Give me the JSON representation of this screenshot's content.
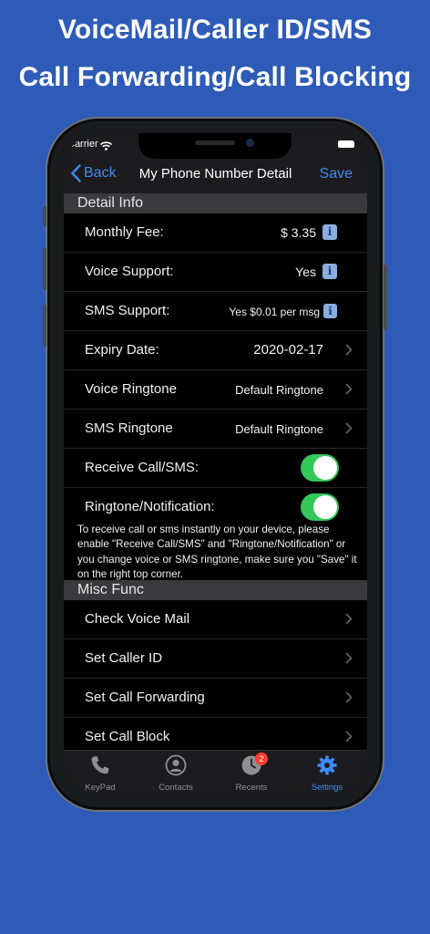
{
  "headline": {
    "line1": "VoiceMail/Caller ID/SMS",
    "line2": "Call Forwarding/Call Blocking"
  },
  "status_bar": {
    "carrier": "Carrier"
  },
  "nav": {
    "back_label": "Back",
    "title": "My Phone Number Detail",
    "save_label": "Save"
  },
  "detail_section": {
    "header": "Detail Info",
    "rows": [
      {
        "label": "Monthly Fee:",
        "value": "$ 3.35"
      },
      {
        "label": "Voice Support:",
        "value": "Yes"
      },
      {
        "label": "SMS Support:",
        "value": "Yes $0.01 per msg"
      },
      {
        "label": "Expiry Date:",
        "value": "2020-02-17"
      },
      {
        "label": "Voice Ringtone",
        "value": "Default Ringtone"
      },
      {
        "label": "SMS Ringtone",
        "value": "Default Ringtone"
      },
      {
        "label": "Receive Call/SMS:",
        "on": true
      },
      {
        "label": "Ringtone/Notification:",
        "on": true
      }
    ],
    "note": "To receive call or sms instantly on your device, please enable \"Receive Call/SMS\" and \"Ringtone/Notification\" or you change voice or SMS ringtone,  make sure you \"Save\" it on the right top corner."
  },
  "misc_section": {
    "header": "Misc Func",
    "rows": [
      {
        "label": "Check Voice Mail"
      },
      {
        "label": "Set Caller ID"
      },
      {
        "label": "Set Call Forwarding"
      },
      {
        "label": "Set Call Block"
      }
    ]
  },
  "tabbar": {
    "tabs": [
      {
        "label": "KeyPad",
        "icon": "phone-icon"
      },
      {
        "label": "Contacts",
        "icon": "contacts-icon"
      },
      {
        "label": "Recents",
        "icon": "clock-icon",
        "badge": "2"
      },
      {
        "label": "Settings",
        "icon": "gear-icon",
        "active": true
      }
    ]
  },
  "colors": {
    "background": "#2e5bb7",
    "accent": "#3d8bf5",
    "toggle_on": "#34c759",
    "badge": "#ff3b30"
  }
}
